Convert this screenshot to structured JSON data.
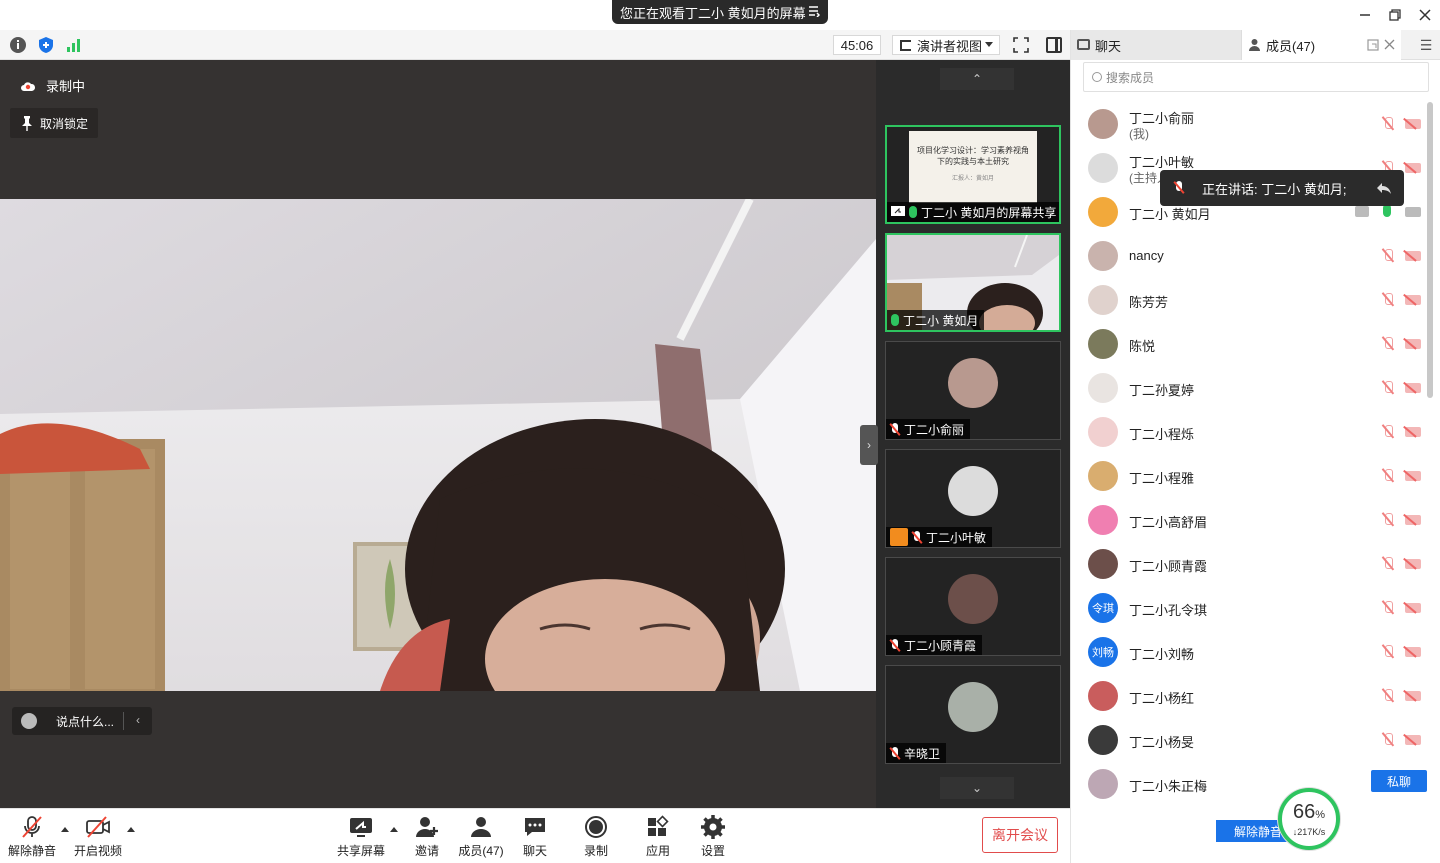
{
  "banner": {
    "text": "您正在观看丁二小 黄如月的屏幕"
  },
  "toolbar": {
    "timer": "45:06",
    "view_mode": "演讲者视图"
  },
  "stage": {
    "recording": "录制中",
    "unpin": "取消锁定",
    "chat_placeholder": "说点什么..."
  },
  "thumbnails": [
    {
      "name": "丁二小 黄如月的屏幕共享",
      "active": true,
      "type": "share"
    },
    {
      "name": "丁二小 黄如月",
      "active": true,
      "type": "video"
    },
    {
      "name": "丁二小俞丽",
      "active": false,
      "type": "avatar"
    },
    {
      "name": "丁二小叶敏",
      "active": false,
      "type": "avatar"
    },
    {
      "name": "丁二小顾青霞",
      "active": false,
      "type": "avatar"
    },
    {
      "name": "辛晓卫",
      "active": false,
      "type": "avatar"
    }
  ],
  "share_slide": {
    "title": "项目化学习设计：学习素养视角下的实践与本土研究",
    "subtitle": "汇报人：黄如月"
  },
  "bottombar": {
    "unmute": "解除静音",
    "start_video": "开启视频",
    "share_screen": "共享屏幕",
    "invite": "邀请",
    "members": "成员(47)",
    "chat": "聊天",
    "record": "录制",
    "apps": "应用",
    "settings": "设置",
    "leave": "离开会议"
  },
  "panel": {
    "tab_chat": "聊天",
    "tab_members": "成员(47)",
    "search_placeholder": "搜索成员",
    "members": [
      {
        "name": "丁二小俞丽",
        "sub": "(我)",
        "avatar_color": "#b8998f"
      },
      {
        "name": "丁二小叶敏",
        "sub": "(主持人",
        "avatar_color": "#dcdcdc"
      },
      {
        "name": "丁二小 黄如月",
        "sub": "",
        "avatar_color": "#f2a93b",
        "live": true
      },
      {
        "name": "nancy",
        "sub": "",
        "avatar_color": "#c9b3ad"
      },
      {
        "name": "陈芳芳",
        "sub": "",
        "avatar_color": "#e0d2cd"
      },
      {
        "name": "陈悦",
        "sub": "",
        "avatar_color": "#7b7a5c"
      },
      {
        "name": "丁二孙夏婷",
        "sub": "",
        "avatar_color": "#e9e4e1"
      },
      {
        "name": "丁二小程烁",
        "sub": "",
        "avatar_color": "#f1d0d0"
      },
      {
        "name": "丁二小程雅",
        "sub": "",
        "avatar_color": "#d9ad6f"
      },
      {
        "name": "丁二小高舒眉",
        "sub": "",
        "avatar_color": "#f07fb1"
      },
      {
        "name": "丁二小顾青霞",
        "sub": "",
        "avatar_color": "#6c4f4a"
      },
      {
        "name": "丁二小孔令琪",
        "sub": "",
        "avatar_color": "#1a73e8",
        "initials": "令琪"
      },
      {
        "name": "丁二小刘畅",
        "sub": "",
        "avatar_color": "#1a73e8",
        "initials": "刘畅"
      },
      {
        "name": "丁二小杨红",
        "sub": "",
        "avatar_color": "#c95d5d"
      },
      {
        "name": "丁二小杨旻",
        "sub": "",
        "avatar_color": "#3a3a3a"
      },
      {
        "name": "丁二小朱正梅",
        "sub": "",
        "avatar_color": "#bda7b4",
        "dm": "私聊"
      }
    ],
    "speaking_tooltip": "正在讲话: 丁二小 黄如月;",
    "unmute_all": "解除静音"
  },
  "network": {
    "percent": "66",
    "percent_unit": "%",
    "speed": "217K/s"
  },
  "colors": {
    "accent": "#1a73e8",
    "live": "#2ec45f",
    "danger": "#e14c4c"
  }
}
